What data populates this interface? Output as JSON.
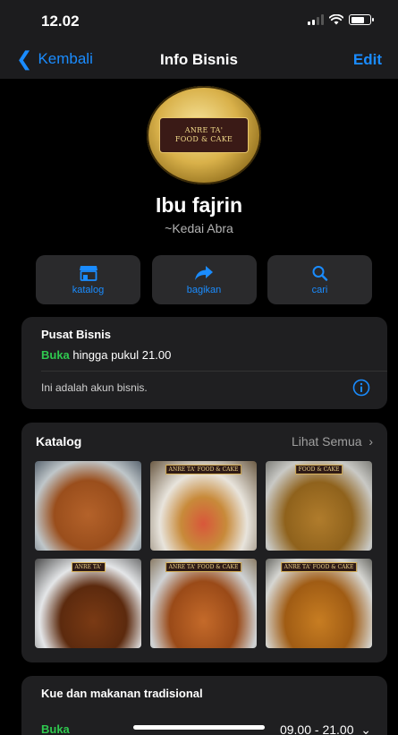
{
  "status_bar": {
    "time": "12.02"
  },
  "nav": {
    "back_label": "Kembali",
    "title": "Info Bisnis",
    "edit_label": "Edit"
  },
  "profile": {
    "logo_text_line1": "ANRE TA'",
    "logo_text_line2": "FOOD & CAKE",
    "name": "Ibu fajrin",
    "handle": "~Kedai Abra"
  },
  "actions": [
    {
      "label": "katalog",
      "icon": "store-icon"
    },
    {
      "label": "bagikan",
      "icon": "share-arrow-icon"
    },
    {
      "label": "cari",
      "icon": "search-icon"
    }
  ],
  "business_center": {
    "title": "Pusat Bisnis",
    "status": "Buka",
    "hours_text": "hingga pukul 21.00",
    "note": "Ini adalah akun bisnis.",
    "status_color": "#2fc84f"
  },
  "catalog": {
    "title": "Katalog",
    "see_all": "Lihat Semua",
    "items": [
      {
        "id": "thumb-1"
      },
      {
        "id": "thumb-2",
        "tag": "ANRE TA' FOOD & CAKE"
      },
      {
        "id": "thumb-3",
        "tag": "FOOD & CAKE"
      },
      {
        "id": "thumb-4",
        "tag": "ANRE TA'"
      },
      {
        "id": "thumb-5",
        "tag": "ANRE TA' FOOD & CAKE"
      },
      {
        "id": "thumb-6",
        "tag": "ANRE TA' FOOD & CAKE"
      }
    ]
  },
  "category": {
    "title": "Kue dan makanan tradisional",
    "status": "Buka",
    "hours": "09.00 - 21.00"
  },
  "colors": {
    "accent": "#1a8cff",
    "open": "#2fc84f",
    "card": "#1f1f21"
  }
}
